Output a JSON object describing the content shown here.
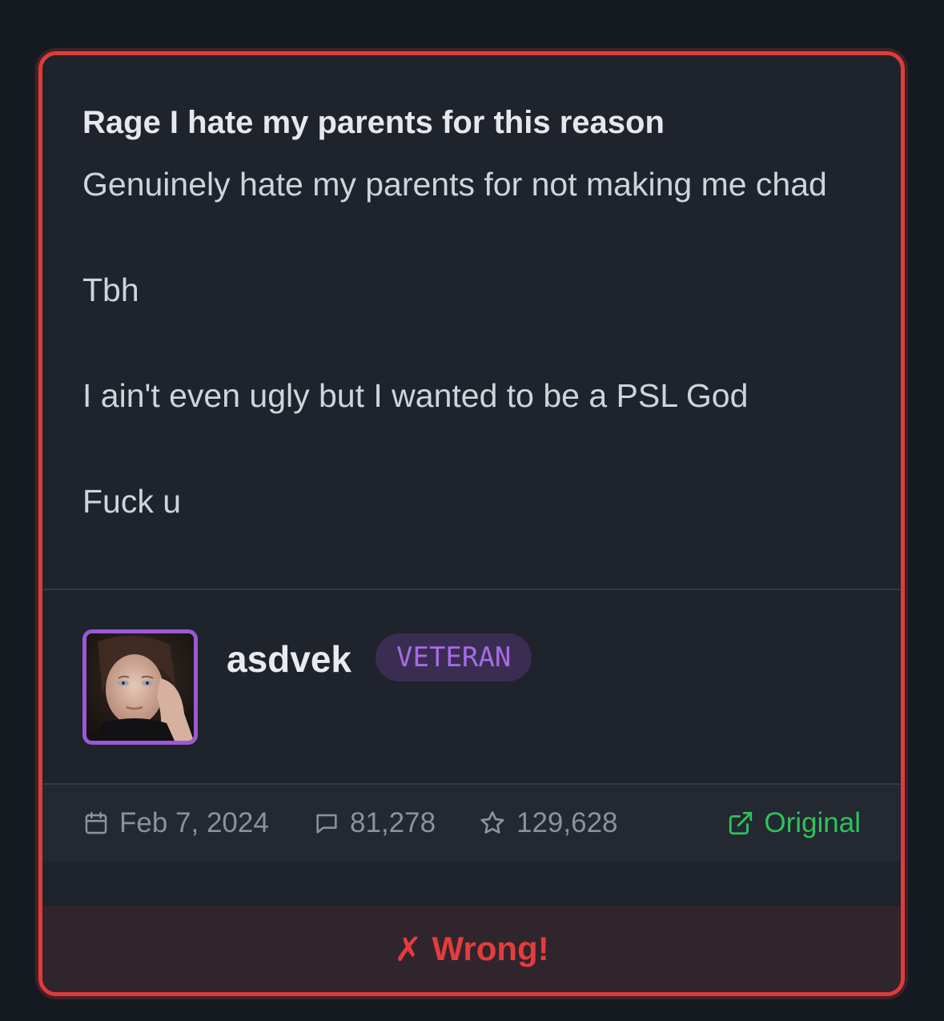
{
  "post": {
    "title": "Rage I hate my parents for this reason",
    "lines": [
      "Genuinely hate my parents for not making me chad",
      "Tbh",
      "I ain't even ugly but I wanted to be a PSL God",
      "Fuck u"
    ]
  },
  "author": {
    "username": "asdvek",
    "badge": "VETERAN"
  },
  "meta": {
    "date": "Feb 7, 2024",
    "comments": "81,278",
    "stars": "129,628",
    "original_label": "Original"
  },
  "verdict": {
    "mark": "✗",
    "label": "Wrong!"
  },
  "colors": {
    "card_border": "#de3b3b",
    "badge_text": "#a66be6",
    "avatar_border": "#9b59d6",
    "original_link": "#2fc25b",
    "verdict_text": "#e43c3c"
  }
}
